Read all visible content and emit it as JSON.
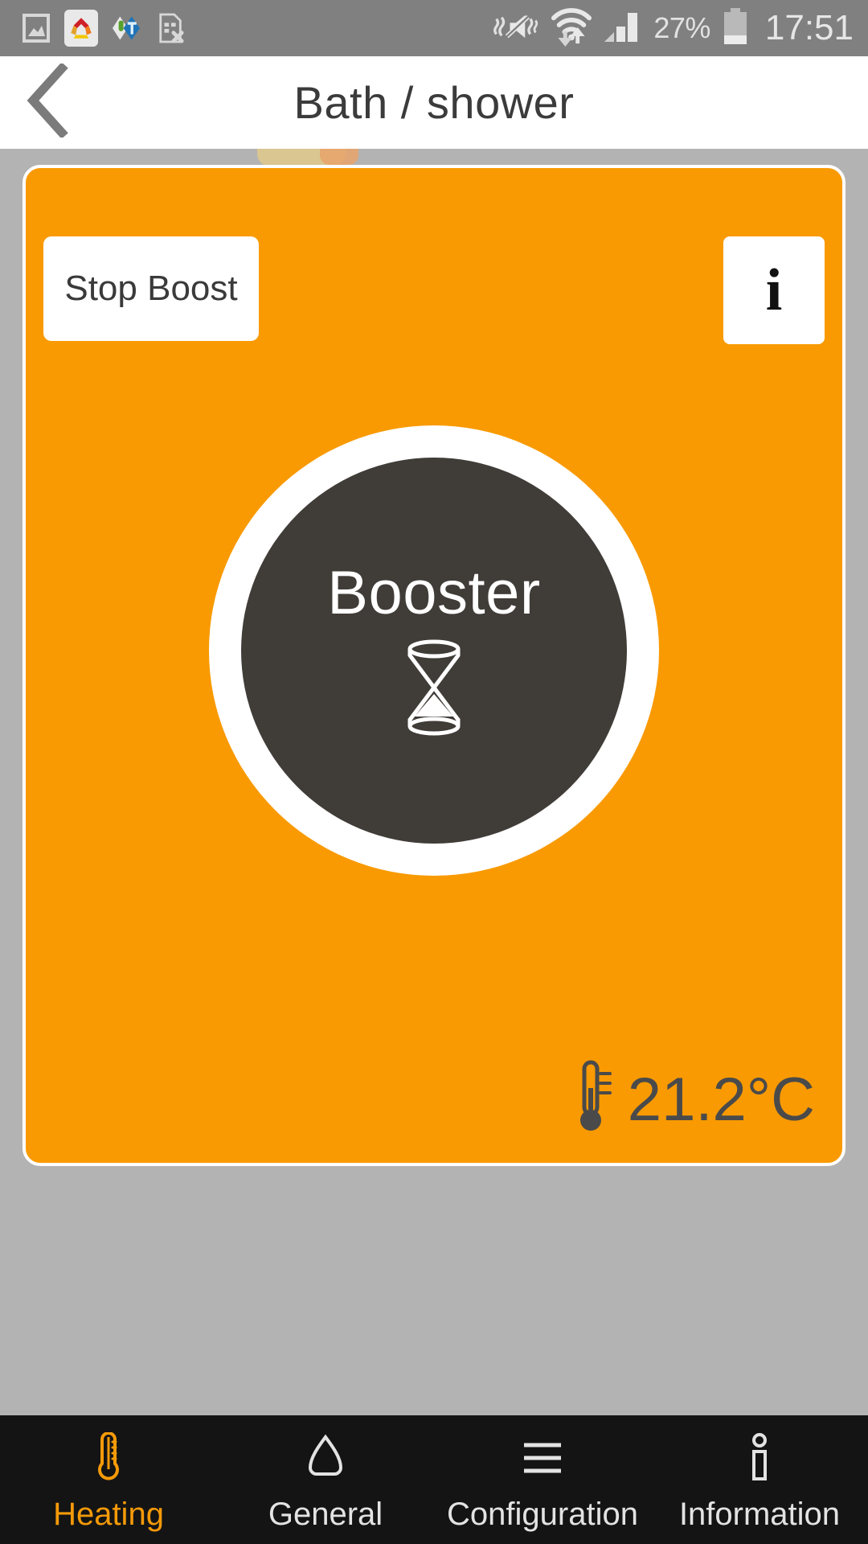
{
  "statusbar": {
    "background": "#808080",
    "left_icons": [
      {
        "name": "gallery-icon",
        "label": "Gallery"
      },
      {
        "name": "home-app-icon",
        "label": "Home app"
      },
      {
        "name": "total-commander-icon",
        "label": "Total Commander"
      },
      {
        "name": "document-error-icon",
        "label": "Document error"
      }
    ],
    "right_icons": [
      {
        "name": "mute-vibrate-icon",
        "label": "Sound off / vibrate"
      },
      {
        "name": "wifi-data-icon",
        "label": "Wi-Fi with data transfer"
      },
      {
        "name": "cellular-signal-icon",
        "label": "Cellular signal"
      }
    ],
    "battery_percent": "27%",
    "battery_level": 27,
    "clock": "17:51"
  },
  "header": {
    "title": "Bath / shower",
    "back_icon": "chevron-left-icon"
  },
  "card": {
    "accent_color": "#f99a02",
    "stop_boost_label": "Stop Boost",
    "info_label": "i",
    "booster_label": "Booster",
    "booster_icon": "hourglass-icon",
    "temperature": "21.2°C",
    "temperature_icon": "thermometer-icon"
  },
  "bottomnav": {
    "active_color": "#f59a09",
    "items": [
      {
        "label": "Heating",
        "icon": "thermometer-icon",
        "active": true
      },
      {
        "label": "General",
        "icon": "home-icon",
        "active": false
      },
      {
        "label": "Configuration",
        "icon": "menu-lines-icon",
        "active": false
      },
      {
        "label": "Information",
        "icon": "info-icon",
        "active": false
      }
    ]
  }
}
